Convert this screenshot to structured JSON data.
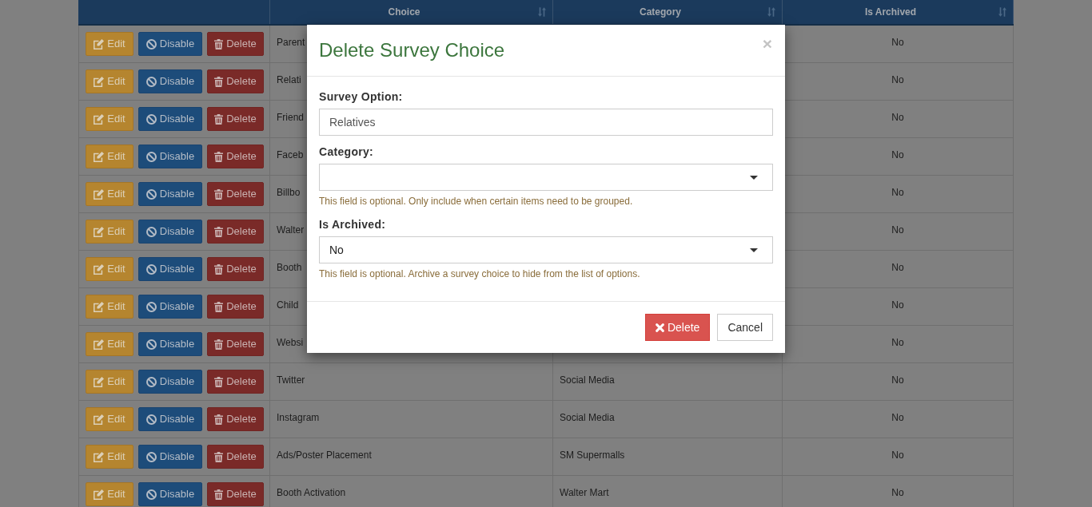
{
  "table": {
    "columns": [
      "Choice",
      "Category",
      "Is Archived"
    ],
    "rows": [
      {
        "actions": [
          {
            "kind": "edit",
            "label": "Edit"
          },
          {
            "kind": "disable",
            "label": "Disable"
          },
          {
            "kind": "delete",
            "label": "Delete"
          }
        ],
        "choice": "Parent",
        "is_archived": "No"
      },
      {
        "actions": [
          {
            "kind": "edit",
            "label": "Edit"
          },
          {
            "kind": "disable",
            "label": "Disable"
          },
          {
            "kind": "delete",
            "label": "Delete"
          }
        ],
        "choice": "Relati",
        "is_archived": "No"
      },
      {
        "actions": [
          {
            "kind": "edit",
            "label": "Edit"
          },
          {
            "kind": "disable",
            "label": "Disable"
          },
          {
            "kind": "delete",
            "label": "Delete"
          }
        ],
        "choice": "Friend",
        "is_archived": "No"
      },
      {
        "actions": [
          {
            "kind": "edit",
            "label": "Edit"
          },
          {
            "kind": "disable",
            "label": "Disable"
          },
          {
            "kind": "delete",
            "label": "Delete"
          }
        ],
        "choice": "Faceb",
        "is_archived": "No"
      },
      {
        "actions": [
          {
            "kind": "edit",
            "label": "Edit"
          },
          {
            "kind": "disable",
            "label": "Disable"
          },
          {
            "kind": "delete",
            "label": "Delete"
          }
        ],
        "choice": "Billbo",
        "is_archived": "No"
      },
      {
        "actions": [
          {
            "kind": "edit",
            "label": "Edit"
          },
          {
            "kind": "disable",
            "label": "Disable"
          },
          {
            "kind": "delete",
            "label": "Delete"
          }
        ],
        "choice": "Walter",
        "is_archived": "No"
      },
      {
        "actions": [
          {
            "kind": "edit",
            "label": "Edit"
          },
          {
            "kind": "disable",
            "label": "Disable"
          },
          {
            "kind": "delete",
            "label": "Delete"
          }
        ],
        "choice": "Booth",
        "is_archived": "No"
      },
      {
        "actions": [
          {
            "kind": "edit",
            "label": "Edit"
          },
          {
            "kind": "disable",
            "label": "Disable"
          },
          {
            "kind": "delete",
            "label": "Delete"
          }
        ],
        "choice": "Child",
        "is_archived": "No"
      },
      {
        "actions": [
          {
            "kind": "edit",
            "label": "Edit"
          },
          {
            "kind": "disable",
            "label": "Disable"
          },
          {
            "kind": "delete",
            "label": "Delete"
          }
        ],
        "choice": "Websi",
        "is_archived": "No"
      },
      {
        "actions": [
          {
            "kind": "edit",
            "label": "Edit"
          },
          {
            "kind": "disable",
            "label": "Disable"
          },
          {
            "kind": "delete",
            "label": "Delete"
          }
        ],
        "choice": "Twitter",
        "category": "Social Media",
        "is_archived": "No"
      },
      {
        "actions": [
          {
            "kind": "edit",
            "label": "Edit"
          },
          {
            "kind": "disable",
            "label": "Disable"
          },
          {
            "kind": "delete",
            "label": "Delete"
          }
        ],
        "choice": "Instagram",
        "category": "Social Media",
        "is_archived": "No"
      },
      {
        "actions": [
          {
            "kind": "edit",
            "label": "Edit"
          },
          {
            "kind": "disable",
            "label": "Disable"
          },
          {
            "kind": "delete",
            "label": "Delete"
          }
        ],
        "choice": "Ads/Poster Placement",
        "category": "SM Supermalls",
        "is_archived": "No"
      },
      {
        "actions": [
          {
            "kind": "edit",
            "label": "Edit"
          },
          {
            "kind": "disable",
            "label": "Disable"
          },
          {
            "kind": "delete",
            "label": "Delete"
          }
        ],
        "choice": "Booth Activation",
        "category": "Walter Mart",
        "is_archived": "No"
      }
    ]
  },
  "modal": {
    "title": "Delete Survey Choice",
    "close": "×",
    "fields": [
      {
        "kind": "text",
        "label": "Survey Option:",
        "value": "Relatives"
      },
      {
        "kind": "select",
        "label": "Category:",
        "help": "This field is optional. Only include when certain items need to be grouped."
      },
      {
        "kind": "select",
        "label": "Is Archived:",
        "value": "No",
        "help": "This field is optional. Archive a survey choice to hide from the list of options."
      }
    ],
    "buttons": [
      {
        "kind": "danger",
        "label": "Delete"
      },
      {
        "kind": "default",
        "label": "Cancel"
      }
    ]
  }
}
